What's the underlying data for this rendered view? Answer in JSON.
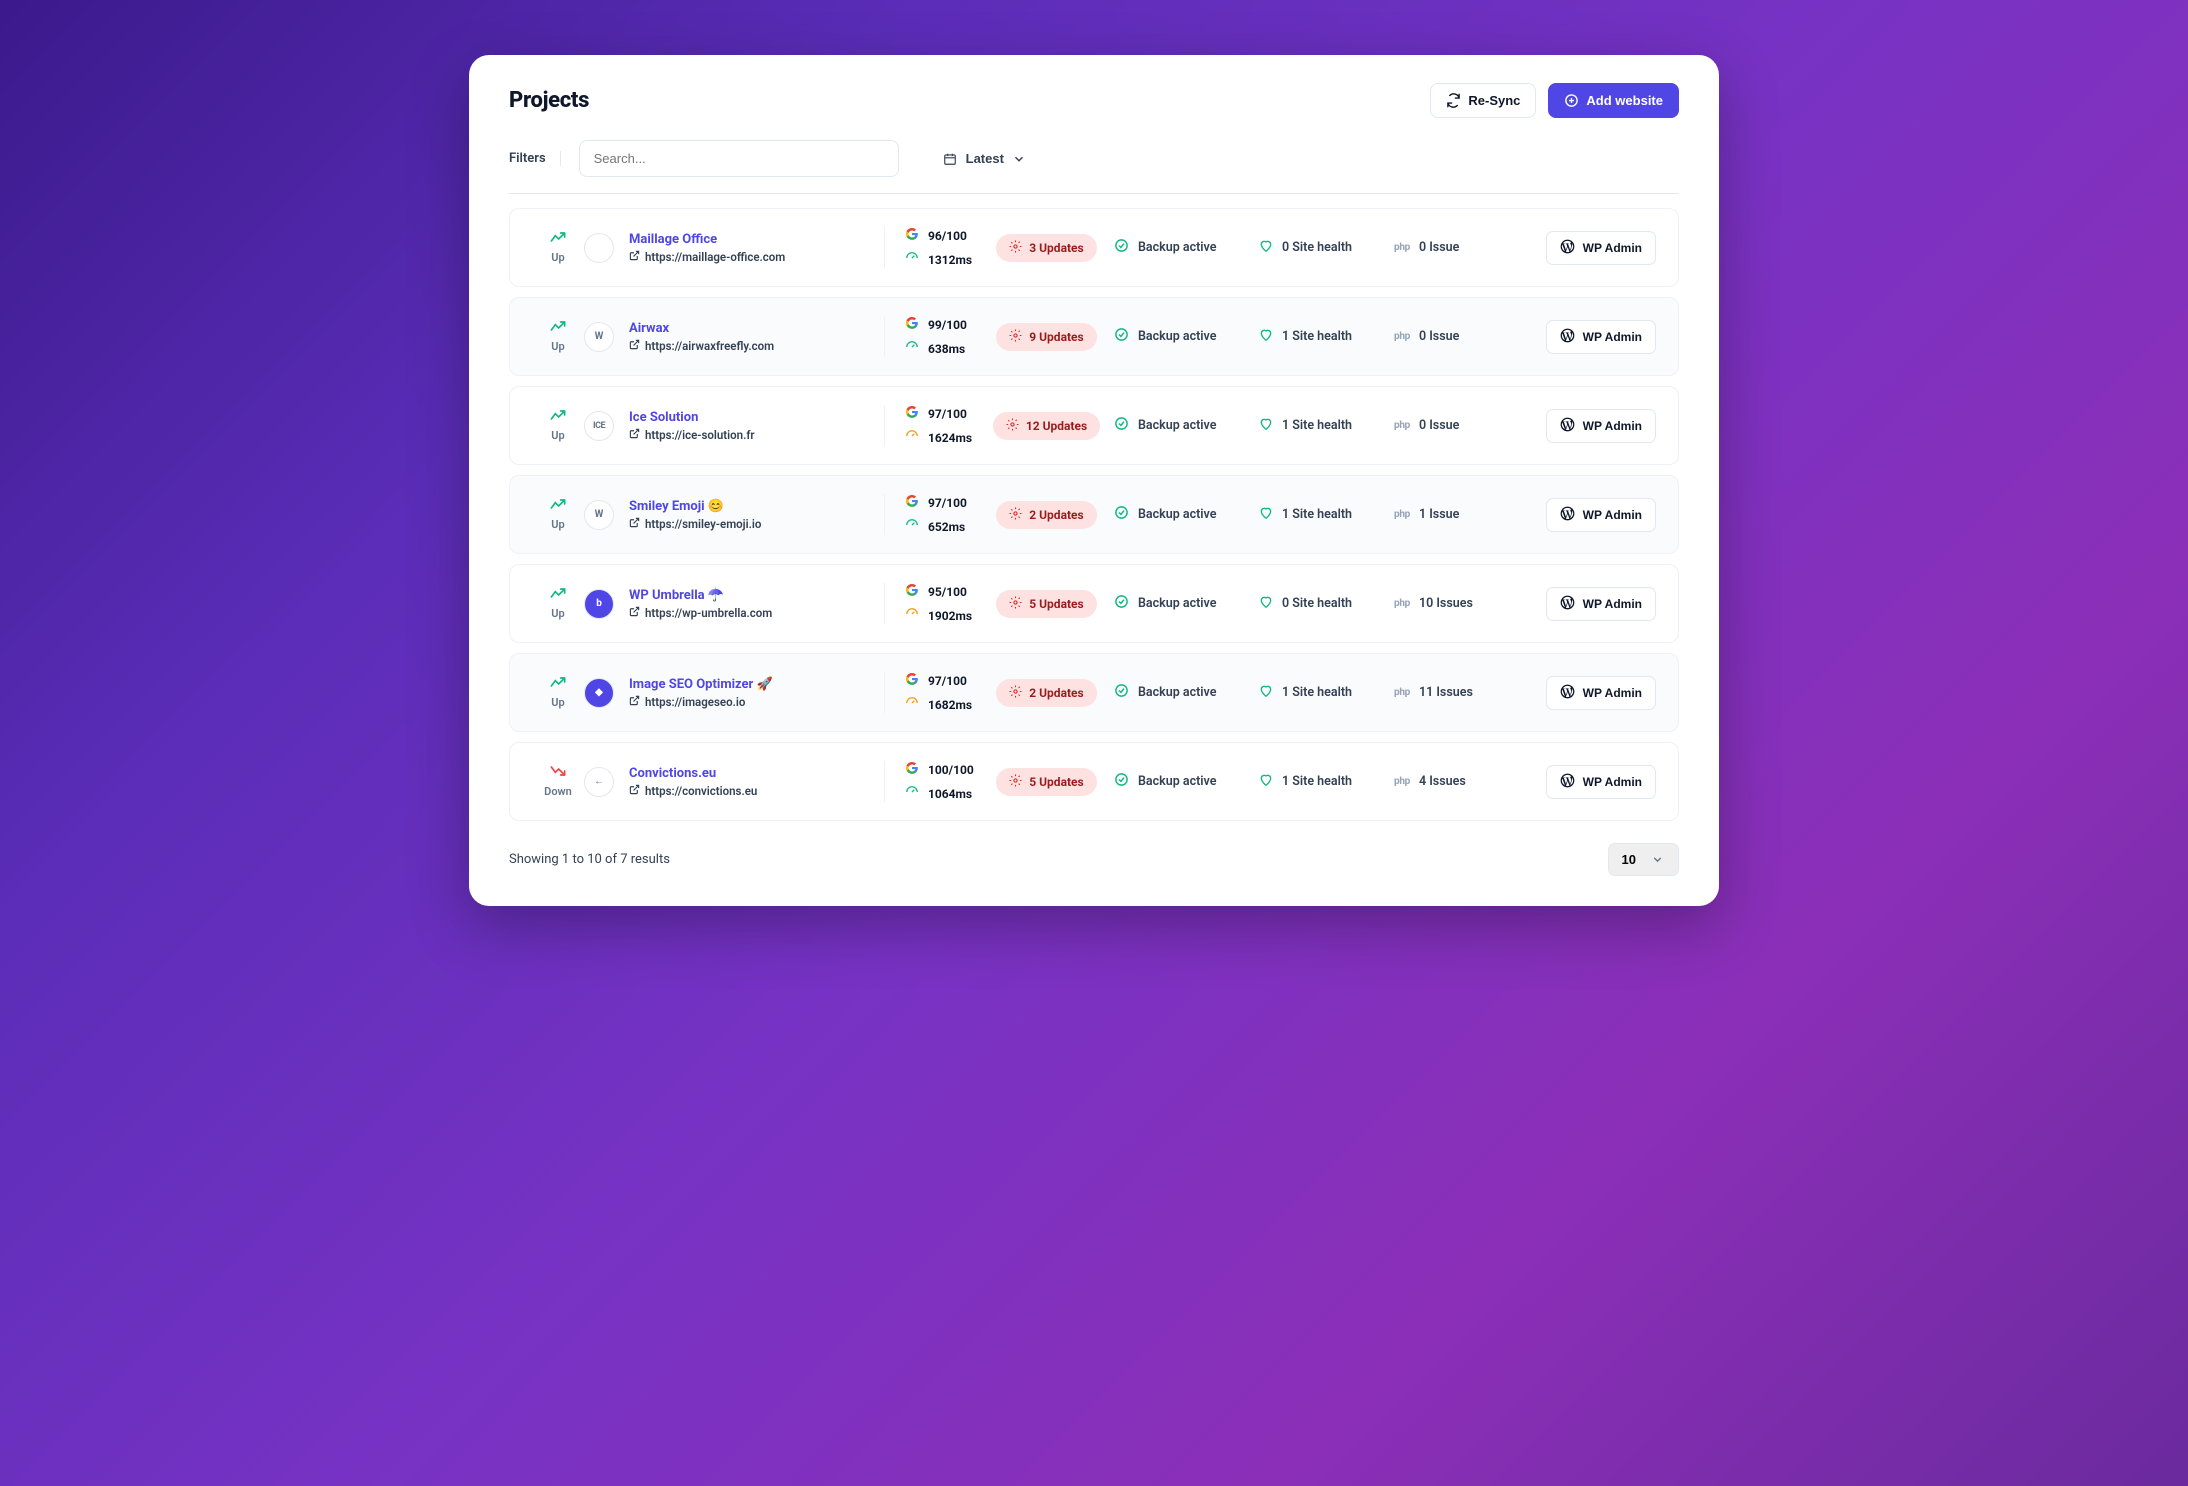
{
  "page": {
    "title": "Projects",
    "resync": "Re-Sync",
    "add": "Add website",
    "filters": "Filters",
    "search_placeholder": "Search...",
    "sort": "Latest",
    "results": "Showing 1 to 10 of 7 results",
    "pagesize": "10"
  },
  "rows": [
    {
      "status": "Up",
      "up": true,
      "avatar": "",
      "avatar_cls": "",
      "name": "Maillage Office",
      "url": "https://maillage-office.com",
      "score": "96/100",
      "speed": "1312ms",
      "speed_cls": "green-ico",
      "updates": "3 Updates",
      "backup": "Backup active",
      "health": "0 Site health",
      "issues": "0 Issue",
      "admin": "WP Admin",
      "alt": false
    },
    {
      "status": "Up",
      "up": true,
      "avatar": "W",
      "avatar_cls": "wp",
      "name": "Airwax",
      "url": "https://airwaxfreefly.com",
      "score": "99/100",
      "speed": "638ms",
      "speed_cls": "green-ico",
      "updates": "9 Updates",
      "backup": "Backup active",
      "health": "1 Site health",
      "issues": "0 Issue",
      "admin": "WP Admin",
      "alt": true
    },
    {
      "status": "Up",
      "up": true,
      "avatar": "ICE",
      "avatar_cls": "ice",
      "name": "Ice Solution",
      "url": "https://ice-solution.fr",
      "score": "97/100",
      "speed": "1624ms",
      "speed_cls": "orange-ico",
      "updates": "12 Updates",
      "backup": "Backup active",
      "health": "1 Site health",
      "issues": "0 Issue",
      "admin": "WP Admin",
      "alt": false
    },
    {
      "status": "Up",
      "up": true,
      "avatar": "W",
      "avatar_cls": "wp",
      "name": "Smiley Emoji 😊",
      "url": "https://smiley-emoji.io",
      "score": "97/100",
      "speed": "652ms",
      "speed_cls": "green-ico",
      "updates": "2 Updates",
      "backup": "Backup active",
      "health": "1 Site health",
      "issues": "1 Issue",
      "admin": "WP Admin",
      "alt": true
    },
    {
      "status": "Up",
      "up": true,
      "avatar": "b",
      "avatar_cls": "blue",
      "name": "WP Umbrella ☂️",
      "url": "https://wp-umbrella.com",
      "score": "95/100",
      "speed": "1902ms",
      "speed_cls": "orange-ico",
      "updates": "5 Updates",
      "backup": "Backup active",
      "health": "0 Site health",
      "issues": "10 Issues",
      "admin": "WP Admin",
      "alt": false
    },
    {
      "status": "Up",
      "up": true,
      "avatar": "◆",
      "avatar_cls": "blue",
      "name": "Image SEO Optimizer 🚀",
      "url": "https://imageseo.io",
      "score": "97/100",
      "speed": "1682ms",
      "speed_cls": "orange-ico",
      "updates": "2 Updates",
      "backup": "Backup active",
      "health": "1 Site health",
      "issues": "11 Issues",
      "admin": "WP Admin",
      "alt": true
    },
    {
      "status": "Down",
      "up": false,
      "avatar": "←",
      "avatar_cls": "",
      "name": "Convictions.eu",
      "url": "https://convictions.eu",
      "score": "100/100",
      "speed": "1064ms",
      "speed_cls": "green-ico",
      "updates": "5 Updates",
      "backup": "Backup active",
      "health": "1 Site health",
      "issues": "4 Issues",
      "admin": "WP Admin",
      "alt": false
    }
  ]
}
